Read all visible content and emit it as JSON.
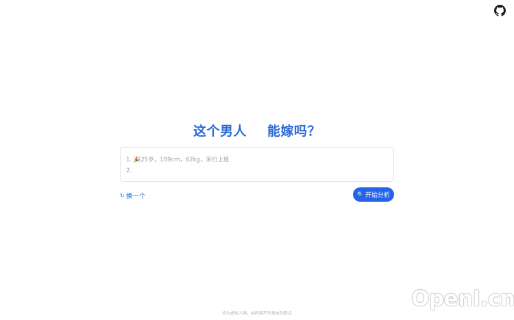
{
  "header": {
    "github_icon": "github-icon"
  },
  "main": {
    "title_part1": "这个男人",
    "title_part2": "能嫁吗？",
    "input_lines": [
      "1. 🎉25岁，189cm，62kg，米行上班",
      "2."
    ],
    "swap_label": "换一个",
    "swap_icon": "↻",
    "analyze_label": "开始分析",
    "analyze_icon": "🔍"
  },
  "footer": {
    "text": "均为虚拟人物，AI内容不代表本站观点"
  },
  "watermark": {
    "text": "OpenI.cn"
  },
  "colors": {
    "accent": "#2b6bd6",
    "button": "#2563eb"
  }
}
